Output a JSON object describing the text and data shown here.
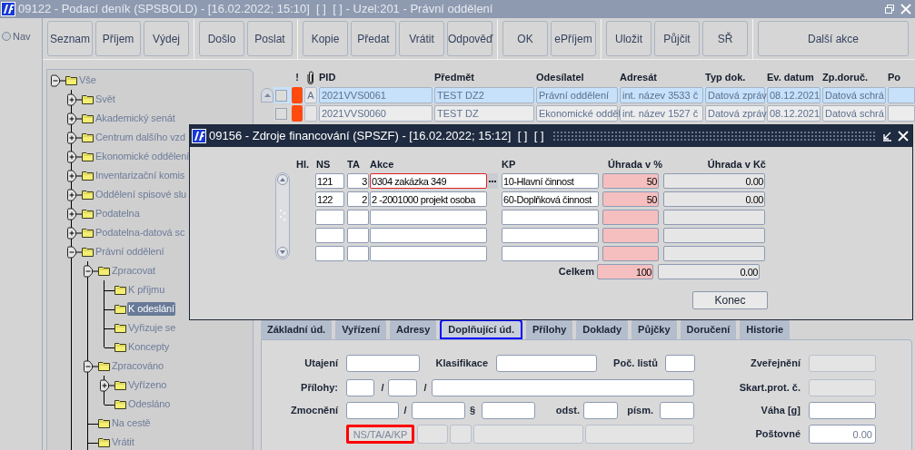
{
  "window": {
    "title": "09122 - Podací deník (SPSBOLD) - [16.02.2022; 15:10]  [ ]  [ ] - Uzel:201 - Právní oddělení"
  },
  "nav": {
    "label": "Nav",
    "selected": false
  },
  "toolbar": {
    "groups": [
      [
        "Seznam",
        "Příjem",
        "Výdej"
      ],
      [
        "Došlo",
        "Poslat"
      ],
      [
        "Kopie",
        "Předat",
        "Vrátit",
        "Odpověď"
      ],
      [
        "OK",
        "ePříjem"
      ],
      [
        "Uložit",
        "Půjčit",
        "SŘ"
      ],
      [
        "Další akce"
      ]
    ]
  },
  "tree": [
    {
      "label": "Vše",
      "expanded": true,
      "selected": false,
      "children": [
        {
          "label": "Svět",
          "expanded": false,
          "selected": false
        },
        {
          "label": "Akademický senát",
          "expanded": false,
          "selected": false
        },
        {
          "label": "Centrum dalšího vzd",
          "expanded": false,
          "selected": false
        },
        {
          "label": "Ekonomické oddělení",
          "expanded": false,
          "selected": false
        },
        {
          "label": "Inventarizační komis",
          "expanded": false,
          "selected": false
        },
        {
          "label": "Oddělení spisové slu",
          "expanded": false,
          "selected": false
        },
        {
          "label": "Podatelna",
          "expanded": false,
          "selected": false
        },
        {
          "label": "Podatelna-datová sc",
          "expanded": false,
          "selected": false
        },
        {
          "label": "Právní oddělení",
          "expanded": true,
          "selected": false,
          "children": [
            {
              "label": "Zpracovat",
              "expanded": true,
              "selected": false,
              "children": [
                {
                  "label": "K příjmu",
                  "selected": false
                },
                {
                  "label": "K odeslání",
                  "selected": true
                },
                {
                  "label": "Vyřizuje se",
                  "selected": false
                },
                {
                  "label": "Koncepty",
                  "selected": false
                }
              ]
            },
            {
              "label": "Zpracováno",
              "expanded": true,
              "selected": false,
              "children": [
                {
                  "label": "Vyřízeno",
                  "expanded": false,
                  "selected": false
                },
                {
                  "label": "Odesláno",
                  "selected": false
                }
              ]
            },
            {
              "label": "Na cestě",
              "selected": false
            },
            {
              "label": "Vrátit",
              "selected": false
            }
          ]
        }
      ]
    }
  ],
  "table": {
    "flag_header": "!",
    "columns": [
      "PID",
      "Předmět",
      "Odesílatel",
      "Adresát",
      "Typ dok.",
      "Ev. datum",
      "Zp.doruč.",
      "Po"
    ],
    "rows": [
      {
        "selected": true,
        "color": "#ff4a10",
        "attachment": "A",
        "cells": [
          "2021VVS0061",
          "TEST DZ2",
          "Právní oddělení",
          "int. název 3533 č",
          "Datová zpráv",
          "08.12.2021",
          "Datová schrá"
        ]
      },
      {
        "selected": false,
        "color": "#ff4a10",
        "cells": [
          "2021VVS0060",
          "TEST DZ",
          "Ekonomické odděl",
          "int. název 1527 č",
          "Datová zpráv",
          "08.12.2021",
          "Datová schrá"
        ]
      }
    ]
  },
  "dialog": {
    "title": "09156 - Zdroje financování (SPSZF) - [16.02.2022; 15:12]  [ ]  [ ]",
    "columns": [
      "Hl.",
      "NS",
      "TA",
      "Akce",
      "KP",
      "Úhrada v %",
      "Úhrada v Kč"
    ],
    "rows": [
      {
        "ns": "121",
        "ta": "3",
        "akce": "0304 zakázka 349",
        "focused": true,
        "kp": "10-Hlavní činnost",
        "pct": "50",
        "kc": "0.00"
      },
      {
        "ns": "122",
        "ta": "2",
        "akce": "2 -2001000 projekt osoba",
        "focused": false,
        "kp": "60-Doplňková činnost",
        "pct": "50",
        "kc": "0.00"
      },
      {
        "focused": false
      },
      {
        "focused": false
      },
      {
        "focused": false
      }
    ],
    "total": {
      "label": "Celkem",
      "pct": "100",
      "kc": "0.00"
    },
    "close_button": "Konec"
  },
  "tabs": [
    {
      "label": "Základní úd.",
      "selected": false
    },
    {
      "label": "Vyřízení",
      "selected": false
    },
    {
      "label": "Adresy",
      "selected": false
    },
    {
      "label": "Doplňující úd.",
      "selected": true
    },
    {
      "label": "Přílohy",
      "selected": false
    },
    {
      "label": "Doklady",
      "selected": false
    },
    {
      "label": "Půjčky",
      "selected": false
    },
    {
      "label": "Doručení",
      "selected": false
    },
    {
      "label": "Historie",
      "selected": false
    }
  ],
  "form": {
    "lines": [
      {
        "items": [
          {
            "kind": "label",
            "text": "Utajení"
          },
          {
            "kind": "field",
            "disabled": false
          },
          {
            "kind": "label",
            "text": "Klasifikace"
          },
          {
            "kind": "field",
            "disabled": false
          },
          {
            "kind": "label",
            "text": "Poč. listů"
          },
          {
            "kind": "field",
            "disabled": false
          }
        ]
      },
      {
        "items": [
          {
            "kind": "label",
            "text": "Přílohy:"
          },
          {
            "kind": "field",
            "disabled": false
          },
          {
            "kind": "sep",
            "text": "/"
          },
          {
            "kind": "field",
            "disabled": false
          },
          {
            "kind": "sep",
            "text": "/"
          },
          {
            "kind": "field",
            "disabled": false
          }
        ]
      },
      {
        "items": [
          {
            "kind": "label",
            "text": "Zmocnění"
          },
          {
            "kind": "field",
            "disabled": false
          },
          {
            "kind": "sep",
            "text": "/"
          },
          {
            "kind": "field",
            "disabled": false
          },
          {
            "kind": "sep",
            "text": "§"
          },
          {
            "kind": "field",
            "disabled": false
          },
          {
            "kind": "label",
            "text": "odst."
          },
          {
            "kind": "field",
            "disabled": false
          },
          {
            "kind": "label",
            "text": "písm."
          },
          {
            "kind": "field",
            "disabled": false
          }
        ]
      },
      {
        "items": [
          {
            "kind": "button",
            "text": "NS/TA/A/KP",
            "highlighted": true
          },
          {
            "kind": "field",
            "disabled": true
          },
          {
            "kind": "field",
            "disabled": true
          },
          {
            "kind": "field",
            "disabled": true
          },
          {
            "kind": "field",
            "disabled": true
          }
        ]
      }
    ],
    "side": [
      {
        "label": "Zveřejnění",
        "disabled": true
      },
      {
        "label": "Skart.prot. č.",
        "disabled": true
      },
      {
        "label": "Váha [g]",
        "disabled": false
      },
      {
        "label": "Poštovné",
        "disabled": false,
        "value": "0.00"
      }
    ]
  }
}
